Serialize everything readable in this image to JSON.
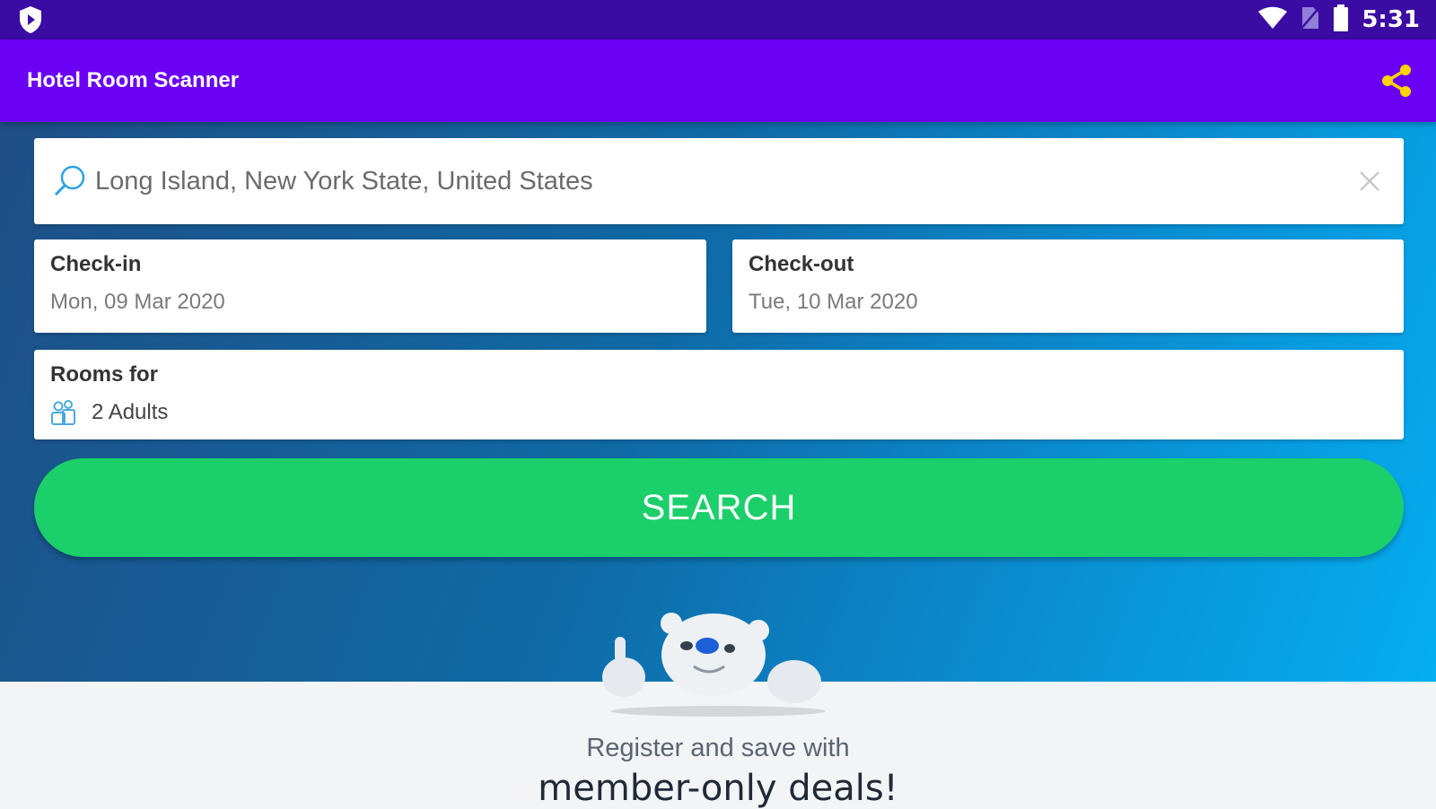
{
  "status_bar": {
    "time": "5:31",
    "icons": [
      "shield-play-icon",
      "wifi-icon",
      "no-sim-icon",
      "battery-icon"
    ]
  },
  "app_bar": {
    "title": "Hotel Room Scanner",
    "share_icon": "share-icon"
  },
  "search": {
    "destination": "Long Island, New York State, United States",
    "search_icon": "search-icon",
    "clear_icon": "close-icon"
  },
  "dates": {
    "checkin_label": "Check-in",
    "checkin_value": "Mon, 09 Mar 2020",
    "checkout_label": "Check-out",
    "checkout_value": "Tue, 10 Mar 2020"
  },
  "rooms": {
    "label": "Rooms for",
    "value": "2 Adults",
    "icon": "guests-icon"
  },
  "search_button_label": "SEARCH",
  "promo": {
    "subtitle": "Register and save with",
    "title": "member-only deals!"
  },
  "colors": {
    "status_bar": "#3a0ca3",
    "app_bar": "#6a00f4",
    "accent_share": "#ffd400",
    "search_button": "#1bcf6a",
    "hero_start": "#1e4f86",
    "hero_end": "#04aef0"
  }
}
